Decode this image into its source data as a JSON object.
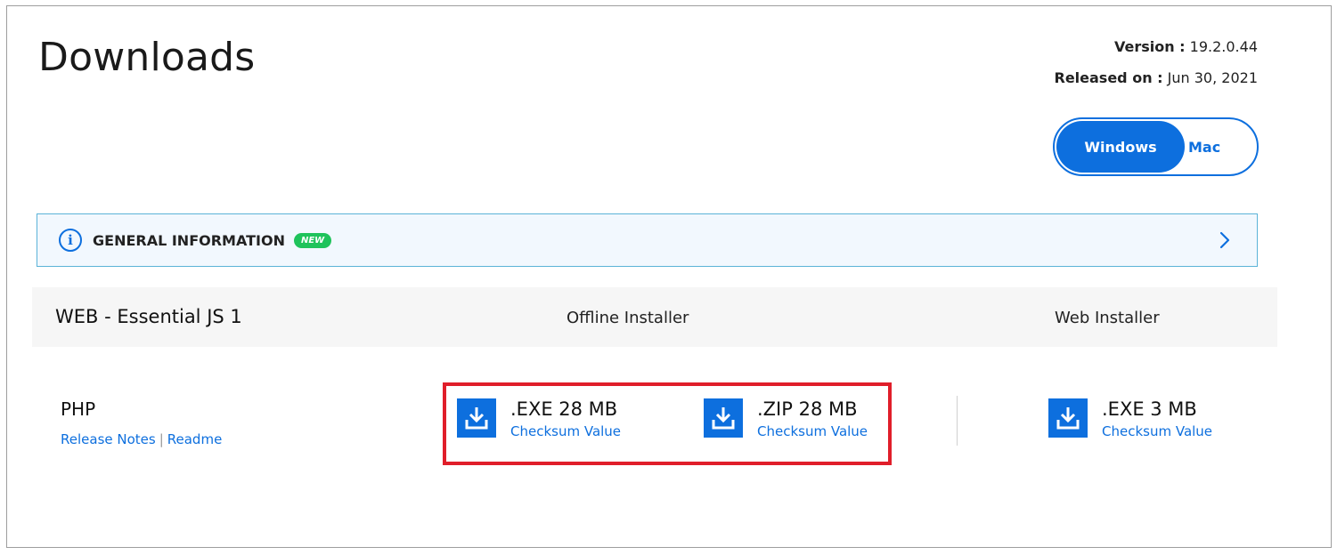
{
  "page": {
    "title": "Downloads"
  },
  "meta": {
    "version_label": "Version :",
    "version_value": "19.2.0.44",
    "released_label": "Released on :",
    "released_value": "Jun 30, 2021"
  },
  "os_toggle": {
    "windows": "Windows",
    "mac": "Mac",
    "selected": "Windows"
  },
  "info_bar": {
    "icon": "info-icon",
    "label": "GENERAL INFORMATION",
    "badge": "NEW"
  },
  "table": {
    "product": "WEB - Essential JS 1",
    "offline_header": "Offline Installer",
    "web_header": "Web Installer"
  },
  "row": {
    "name": "PHP",
    "release_notes": "Release Notes",
    "separator": "|",
    "readme": "Readme",
    "offline": [
      {
        "size": ".EXE 28 MB",
        "checksum": "Checksum Value"
      },
      {
        "size": ".ZIP 28 MB",
        "checksum": "Checksum Value"
      }
    ],
    "web": {
      "size": ".EXE 3 MB",
      "checksum": "Checksum Value"
    }
  },
  "colors": {
    "accent": "#0d6fde",
    "highlight": "#e01e2a",
    "badge": "#1fc35b"
  }
}
